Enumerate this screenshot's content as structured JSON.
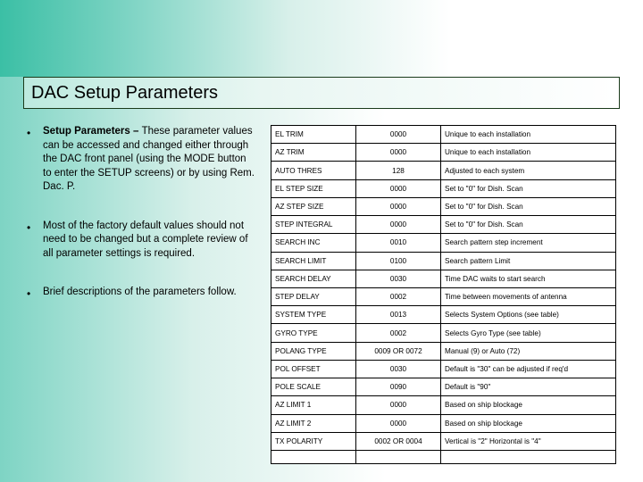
{
  "title": "DAC Setup Parameters",
  "bullets": [
    {
      "strong": "Setup Parameters – ",
      "rest": "These parameter values can be accessed and changed either through the DAC front panel (using the MODE button to enter the SETUP screens) or by using Rem. Dac. P."
    },
    {
      "strong": "",
      "rest": "Most of the factory default values should not need to be changed but a complete review of all parameter settings is required."
    },
    {
      "strong": "",
      "rest": "Brief descriptions of the parameters follow."
    }
  ],
  "rows": [
    {
      "p": "EL TRIM",
      "v": "0000",
      "d": "Unique to each installation"
    },
    {
      "p": "AZ TRIM",
      "v": "0000",
      "d": "Unique to each installation"
    },
    {
      "p": "AUTO THRES",
      "v": "128",
      "d": "Adjusted to each system"
    },
    {
      "p": "EL STEP SIZE",
      "v": "0000",
      "d": "Set to \"0\" for Dish. Scan"
    },
    {
      "p": "AZ STEP SIZE",
      "v": "0000",
      "d": "Set to \"0\" for Dish. Scan"
    },
    {
      "p": "STEP INTEGRAL",
      "v": "0000",
      "d": "Set to \"0\" for Dish. Scan"
    },
    {
      "p": "SEARCH INC",
      "v": "0010",
      "d": "Search pattern step increment"
    },
    {
      "p": "SEARCH LIMIT",
      "v": "0100",
      "d": "Search pattern Limit"
    },
    {
      "p": "SEARCH DELAY",
      "v": "0030",
      "d": "Time DAC waits to start search"
    },
    {
      "p": "STEP DELAY",
      "v": "0002",
      "d": "Time between movements of antenna"
    },
    {
      "p": "SYSTEM TYPE",
      "v": "0013",
      "d": "Selects System Options (see table)"
    },
    {
      "p": "GYRO TYPE",
      "v": "0002",
      "d": "Selects Gyro Type (see table)"
    },
    {
      "p": "POLANG TYPE",
      "v": "0009 OR 0072",
      "d": "Manual (9) or Auto (72)"
    },
    {
      "p": "POL OFFSET",
      "v": "0030",
      "d": "Default is \"30\" can be adjusted if req'd"
    },
    {
      "p": "POLE SCALE",
      "v": "0090",
      "d": "Default is \"90\""
    },
    {
      "p": "AZ LIMIT 1",
      "v": "0000",
      "d": "Based on ship blockage"
    },
    {
      "p": "AZ LIMIT 2",
      "v": "0000",
      "d": "Based on ship blockage"
    },
    {
      "p": "TX POLARITY",
      "v": "0002 OR 0004",
      "d": "Vertical is \"2\"  Horizontal is \"4\""
    }
  ]
}
